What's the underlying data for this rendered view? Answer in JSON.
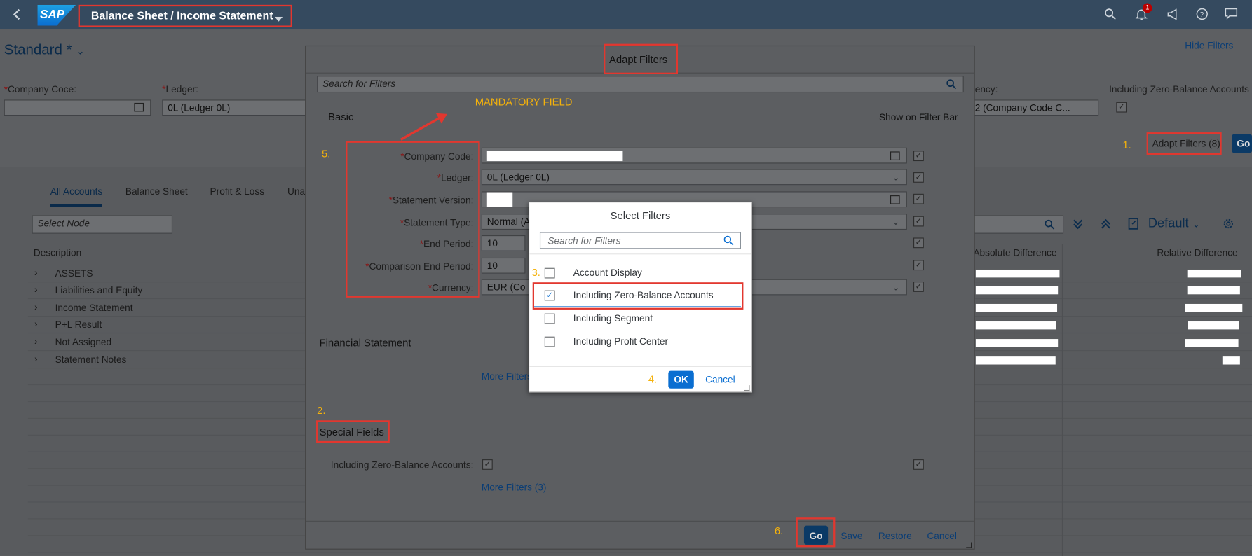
{
  "shell": {
    "logo": "SAP",
    "app_title": "Balance Sheet / Income Statement",
    "notification_count": "1",
    "icons": [
      "back-icon",
      "search-icon",
      "bell-icon",
      "megaphone-icon",
      "help-icon",
      "chat-icon"
    ]
  },
  "page": {
    "variant": "Standard *",
    "hide_filters": "Hide Filters",
    "adapt_filters_btn": "Adapt Filters (8)",
    "go_btn": "Go",
    "filters": {
      "company_code_label": "Company Coce:",
      "ledger_label": "Ledger:",
      "ledger_value": "0L (Ledger 0L)",
      "currency_label": "ency:",
      "currency_value": "2 (Company Code C...",
      "zero_balance_label": "Including Zero-Balance Accounts"
    },
    "tabs": [
      "All Accounts",
      "Balance Sheet",
      "Profit & Loss",
      "Una"
    ],
    "select_node_placeholder": "Select Node",
    "default_view": "Default",
    "table": {
      "headers": {
        "description": "Description",
        "absolute": "Absolute Difference",
        "relative": "Relative Difference"
      },
      "rows": [
        "ASSETS",
        "Liabilities and Equity",
        "Income Statement",
        "P+L Result",
        "Not Assigned",
        "Statement Notes"
      ]
    }
  },
  "adapt_dialog": {
    "title": "Adapt Filters",
    "search_placeholder": "Search for Filters",
    "basic_group": "Basic",
    "show_on_filter_bar": "Show on Filter Bar",
    "fields": {
      "company_code": "Company Code:",
      "ledger": "Ledger:",
      "ledger_value": "0L (Ledger 0L)",
      "statement_version": "Statement Version:",
      "statement_type": "Statement Type:",
      "statement_type_value": "Normal (A",
      "end_period": "End Period:",
      "end_period_value": "10",
      "comparison_end_period": "Comparison End Period:",
      "comparison_end_period_value": "10",
      "currency": "Currency:",
      "currency_value": "EUR (Co"
    },
    "financial_statement_group": "Financial Statement",
    "more_filters_1": "More Filters",
    "special_fields_group": "Special Fields",
    "zero_balance_label": "Including Zero-Balance Accounts:",
    "more_filters_2": "More Filters (3)",
    "footer": {
      "go": "Go",
      "save": "Save",
      "restore": "Restore",
      "cancel": "Cancel"
    }
  },
  "select_dialog": {
    "title": "Select Filters",
    "search_placeholder": "Search for Filters",
    "items": [
      {
        "label": "Account Display",
        "checked": false
      },
      {
        "label": "Including Zero-Balance Accounts",
        "checked": true
      },
      {
        "label": "Including Segment",
        "checked": false
      },
      {
        "label": "Including Profit Center",
        "checked": false
      }
    ],
    "ok": "OK",
    "cancel": "Cancel"
  },
  "annotations": {
    "mandatory": "MANDATORY FIELD",
    "step1": "1.",
    "step2": "2.",
    "step3": "3.",
    "step4": "4.",
    "step5": "5.",
    "step6": "6."
  },
  "colors": {
    "shell": "#354a5f",
    "accent": "#0a6ed1",
    "annotation_red": "#e2372f",
    "annotation_orange": "#f5b20b"
  }
}
